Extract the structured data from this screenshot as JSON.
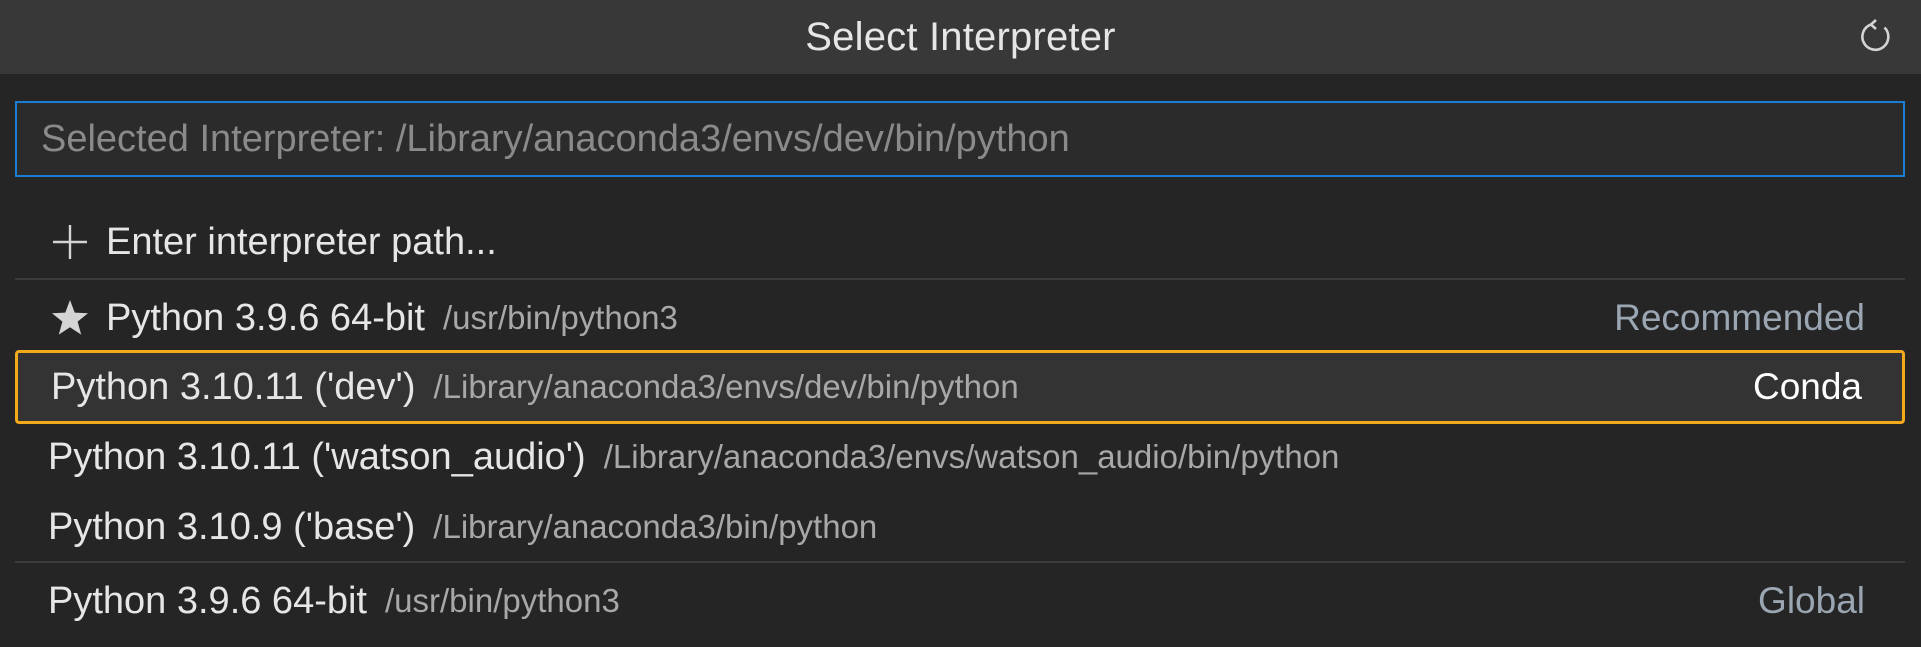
{
  "header": {
    "title": "Select Interpreter",
    "refresh_icon": "refresh-icon"
  },
  "search": {
    "placeholder": "Selected Interpreter: /Library/anaconda3/envs/dev/bin/python",
    "value": ""
  },
  "colors": {
    "focus_border": "#1a7fd4",
    "selected_border": "#f2a91a"
  },
  "items": [
    {
      "icon": "plus-icon",
      "label": "Enter interpreter path...",
      "description": "",
      "detail": ""
    },
    {
      "icon": "star-icon",
      "label": "Python 3.9.6 64-bit",
      "description": "/usr/bin/python3",
      "detail": "Recommended"
    },
    {
      "icon": "",
      "label": "Python 3.10.11 ('dev')",
      "description": "/Library/anaconda3/envs/dev/bin/python",
      "detail": "Conda",
      "selected": true
    },
    {
      "icon": "",
      "label": "Python 3.10.11 ('watson_audio')",
      "description": "/Library/anaconda3/envs/watson_audio/bin/python",
      "detail": ""
    },
    {
      "icon": "",
      "label": "Python 3.10.9 ('base')",
      "description": "/Library/anaconda3/bin/python",
      "detail": ""
    },
    {
      "icon": "",
      "label": "Python 3.9.6 64-bit",
      "description": "/usr/bin/python3",
      "detail": "Global"
    }
  ]
}
